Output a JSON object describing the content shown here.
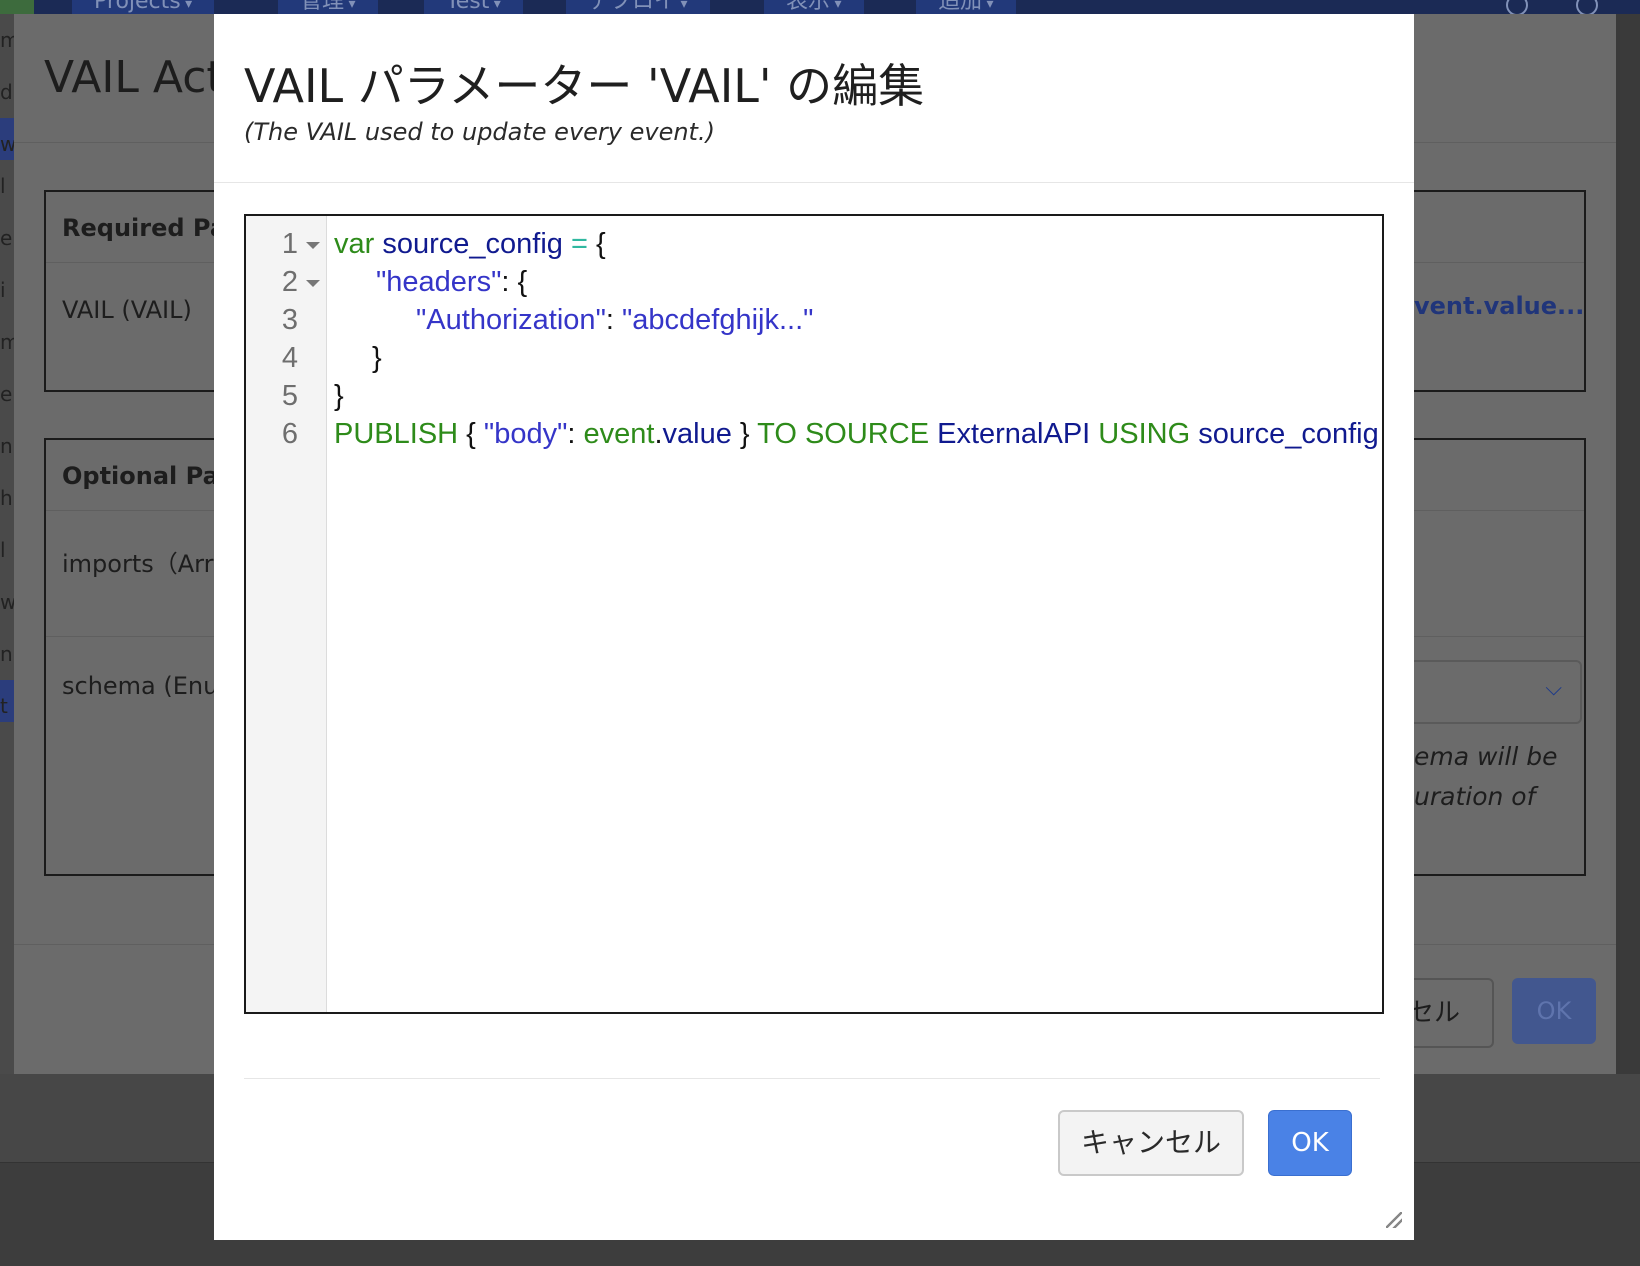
{
  "navbar": {
    "menus": [
      "Projects",
      "管理",
      "Test",
      "デプロイ",
      "表示",
      "追加"
    ]
  },
  "background": {
    "title": "VAIL Acti",
    "required_header": "Required Par",
    "vail_row": "VAIL (VAIL)",
    "vail_value_link": "vent.value...",
    "optional_header": "Optional Par",
    "imports_row": "imports（Arr",
    "schema_row": "schema (Enu",
    "schema_note_line1": "ema will be",
    "schema_note_line2": "uration of",
    "cancel_label": "セル",
    "ok_label": "OK"
  },
  "modal": {
    "title": "VAIL パラメーター 'VAIL' の編集",
    "subtitle": "(The VAIL used to update every event.)",
    "editor": {
      "line_numbers": [
        "1",
        "2",
        "3",
        "4",
        "5",
        "6"
      ],
      "tokens": {
        "l1": [
          "var",
          " source_config ",
          "=",
          " {"
        ],
        "l2": [
          "\"headers\"",
          ": {"
        ],
        "l3": [
          "\"Authorization\"",
          ": ",
          "\"abcdefghijk...\""
        ],
        "l4": [
          "}"
        ],
        "l5": [
          "}"
        ],
        "l6": [
          "PUBLISH",
          " { ",
          "\"body\"",
          ": ",
          "event",
          ".",
          "value",
          " } ",
          "TO SOURCE",
          " ExternalAPI ",
          "USING",
          " source_config"
        ]
      }
    },
    "cancel_label": "キャンセル",
    "ok_label": "OK"
  },
  "colors": {
    "ok_button": "#4a82e6",
    "keyword": "#2e8b1a",
    "identifier": "#101a8f",
    "string": "#3535c8"
  }
}
